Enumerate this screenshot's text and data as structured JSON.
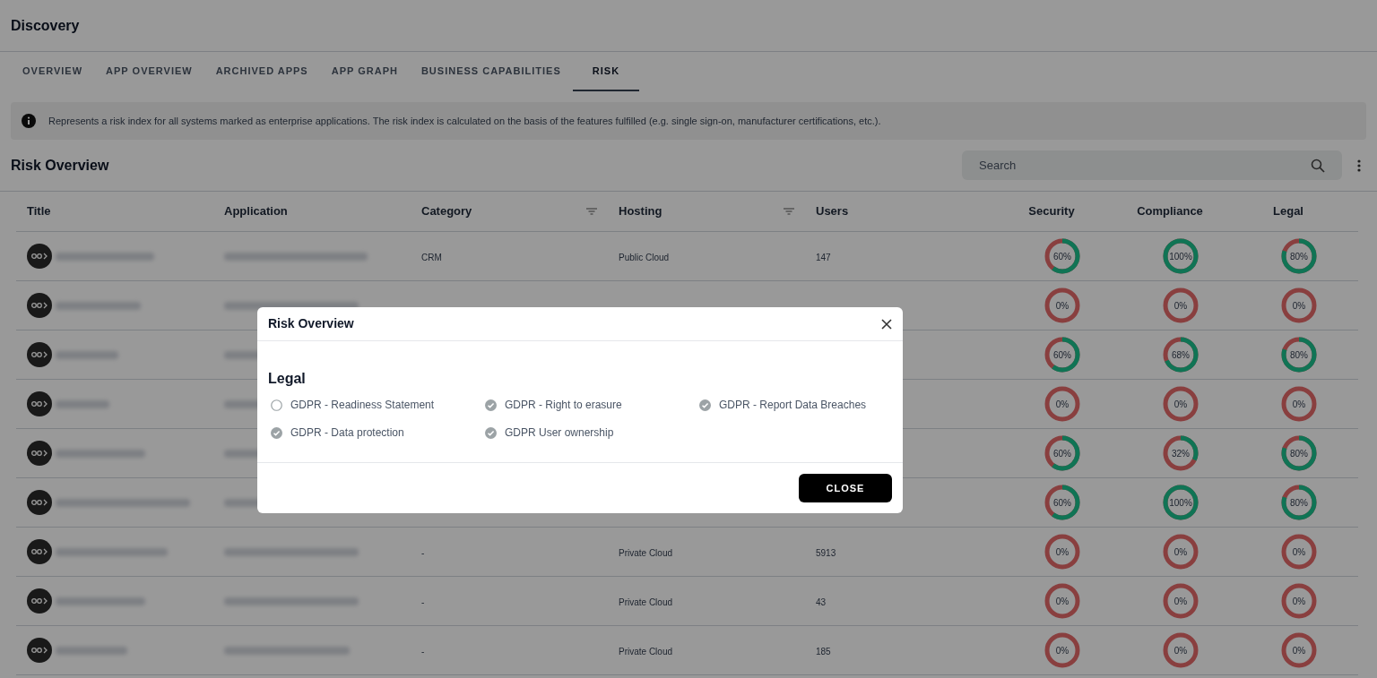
{
  "page": {
    "title": "Discovery"
  },
  "tabs": [
    {
      "label": "OVERVIEW",
      "selected": false
    },
    {
      "label": "APP OVERVIEW",
      "selected": false
    },
    {
      "label": "ARCHIVED APPS",
      "selected": false
    },
    {
      "label": "APP GRAPH",
      "selected": false
    },
    {
      "label": "BUSINESS CAPABILITIES",
      "selected": false
    },
    {
      "label": "RISK",
      "selected": true
    }
  ],
  "info": {
    "text": "Represents a risk index for all systems marked as enterprise applications. The risk index is calculated on the basis of the features fulfilled (e.g. single sign-on, manufacturer certifications, etc.)."
  },
  "section": {
    "title": "Risk Overview",
    "search": {
      "placeholder": "Search"
    }
  },
  "table": {
    "columns": [
      {
        "label": "Title",
        "filterable": false
      },
      {
        "label": "Application",
        "filterable": false
      },
      {
        "label": "Category",
        "filterable": true
      },
      {
        "label": "Hosting",
        "filterable": true
      },
      {
        "label": "Users",
        "filterable": false
      },
      {
        "label": "Security",
        "filterable": false
      },
      {
        "label": "Compliance",
        "filterable": false
      },
      {
        "label": "Legal",
        "filterable": false
      }
    ],
    "rows": [
      {
        "category": "CRM",
        "hosting": "Public Cloud",
        "users": "147",
        "scores": [
          {
            "label": "60%",
            "level": 0.6
          },
          {
            "label": "100%",
            "level": 1
          },
          {
            "label": "80%",
            "level": 0.8
          }
        ]
      },
      {
        "scores": [
          {
            "label": "0%",
            "level": 0
          },
          {
            "label": "0%",
            "level": 0
          },
          {
            "label": "0%",
            "level": 0
          }
        ]
      },
      {
        "scores": [
          {
            "label": "60%",
            "level": 0.6
          },
          {
            "label": "68%",
            "level": 0.68
          },
          {
            "label": "80%",
            "level": 0.8
          }
        ]
      },
      {
        "scores": [
          {
            "label": "0%",
            "level": 0
          },
          {
            "label": "0%",
            "level": 0
          },
          {
            "label": "0%",
            "level": 0
          }
        ]
      },
      {
        "scores": [
          {
            "label": "60%",
            "level": 0.6
          },
          {
            "label": "32%",
            "level": 0.32
          },
          {
            "label": "80%",
            "level": 0.8
          }
        ]
      },
      {
        "scores": [
          {
            "label": "60%",
            "level": 0.6
          },
          {
            "label": "100%",
            "level": 1
          },
          {
            "label": "80%",
            "level": 0.8
          }
        ]
      },
      {
        "category": "-",
        "hosting": "Private Cloud",
        "users": "5913",
        "scores": [
          {
            "label": "0%",
            "level": 0
          },
          {
            "label": "0%",
            "level": 0
          },
          {
            "label": "0%",
            "level": 0
          }
        ]
      },
      {
        "category": "-",
        "hosting": "Private Cloud",
        "users": "43",
        "scores": [
          {
            "label": "0%",
            "level": 0
          },
          {
            "label": "0%",
            "level": 0
          },
          {
            "label": "0%",
            "level": 0
          }
        ]
      },
      {
        "category": "-",
        "hosting": "Private Cloud",
        "users": "185",
        "scores": [
          {
            "label": "0%",
            "level": 0
          },
          {
            "label": "0%",
            "level": 0
          },
          {
            "label": "0%",
            "level": 0
          }
        ]
      }
    ]
  },
  "dialog": {
    "title": "Risk Overview",
    "section": "Legal",
    "items": [
      {
        "label": "GDPR - Readiness Statement",
        "checked": false
      },
      {
        "label": "GDPR - Right to erasure",
        "checked": true
      },
      {
        "label": "GDPR - Report Data Breaches",
        "checked": true
      },
      {
        "label": "GDPR - Data protection",
        "checked": true
      },
      {
        "label": "GDPR User ownership",
        "checked": true
      }
    ],
    "button": "CLOSE"
  }
}
